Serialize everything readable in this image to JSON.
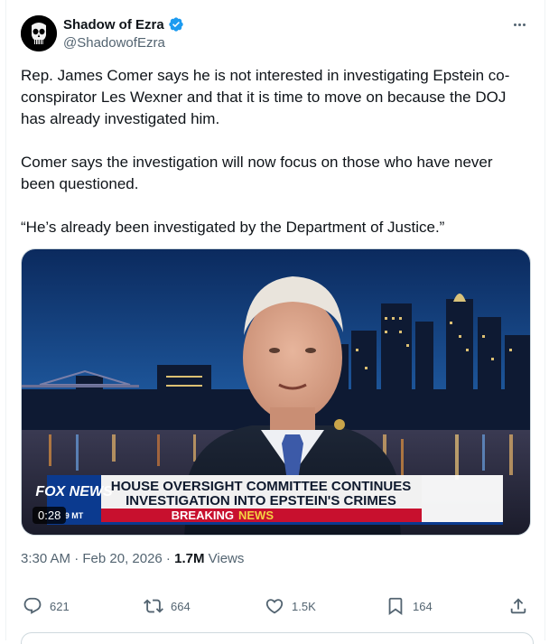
{
  "author": {
    "display_name": "Shadow of Ezra",
    "handle": "@ShadowofEzra",
    "verified": true,
    "avatar_icon": "punisher-skull-icon"
  },
  "tweet": {
    "paragraphs": [
      "Rep. James Comer says he is not interested in investigating Epstein co-conspirator Les Wexner and that it is time to move on because the DOJ has already investigated him.",
      "Comer says the investigation will now focus on those who have never been questioned.",
      "“He’s already been investigated by the Department of Justice.”"
    ],
    "timestamp": "3:30 AM · Feb 20, 2026 · ",
    "views_count": "1.7M",
    "views_label": " Views"
  },
  "video": {
    "duration": "0:28",
    "network_logo": "FOX NEWS",
    "network_sub": "9 MT",
    "chyron_line1": "HOUSE OVERSIGHT COMMITTEE CONTINUES",
    "chyron_line2": "INVESTIGATION INTO EPSTEIN'S CRIMES",
    "breaking_label": "BREAKING",
    "breaking_news": "NEWS"
  },
  "actions": {
    "replies": "621",
    "reposts": "664",
    "likes": "1.5K",
    "bookmarks": "164"
  },
  "colors": {
    "verified_blue": "#1d9bf0",
    "secondary_text": "#536471",
    "fox_red": "#c8102e"
  }
}
